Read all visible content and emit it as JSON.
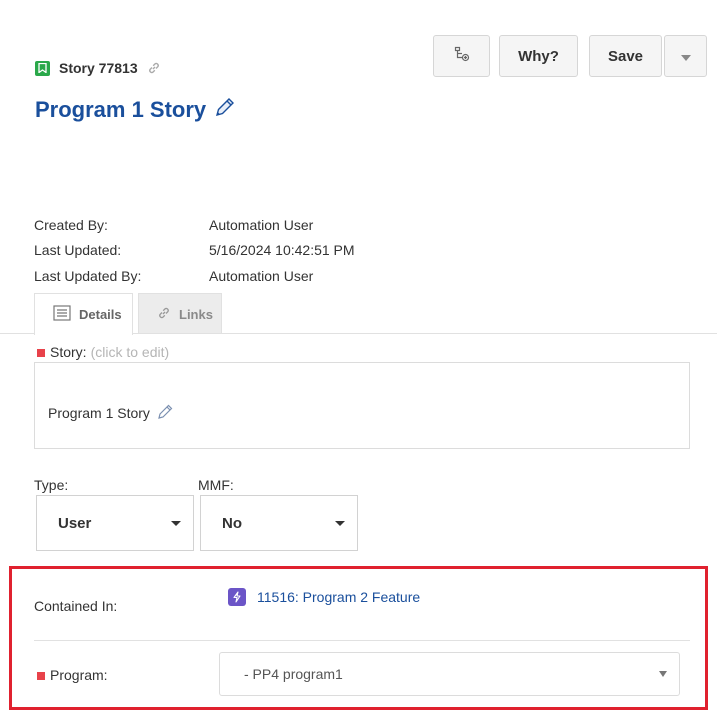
{
  "header": {
    "story_id": "Story 77813",
    "title": "Program 1 Story"
  },
  "toolbar": {
    "why_label": "Why?",
    "save_label": "Save"
  },
  "meta": {
    "created_by_label": "Created By:",
    "created_by_value": "Automation User",
    "last_updated_label": "Last Updated:",
    "last_updated_value": "5/16/2024 10:42:51 PM",
    "last_updated_by_label": "Last Updated By:",
    "last_updated_by_value": "Automation User"
  },
  "tabs": [
    {
      "label": "Details",
      "active": true
    },
    {
      "label": "Links",
      "active": false
    }
  ],
  "story_field": {
    "label": "Story:",
    "hint": "(click to edit)",
    "value": "Program 1 Story"
  },
  "type_field": {
    "label": "Type:",
    "value": "User"
  },
  "mmf_field": {
    "label": "MMF:",
    "value": "No"
  },
  "contained_in": {
    "label": "Contained In:",
    "value": "11516: Program 2 Feature"
  },
  "program_field": {
    "label": "Program:",
    "value": "- PP4 program1"
  },
  "colors": {
    "title": "#1a4f9c",
    "story_icon": "#2aa84a",
    "feature_icon": "#6b55c7",
    "required": "#e8424a",
    "highlight": "#e0212f"
  },
  "icons": {
    "story": "bookmark-icon",
    "link": "link-icon",
    "edit": "pencil-icon",
    "tree": "tree-view-icon",
    "details": "document-lines-icon",
    "links": "chain-link-icon",
    "feature": "lightning-icon"
  }
}
